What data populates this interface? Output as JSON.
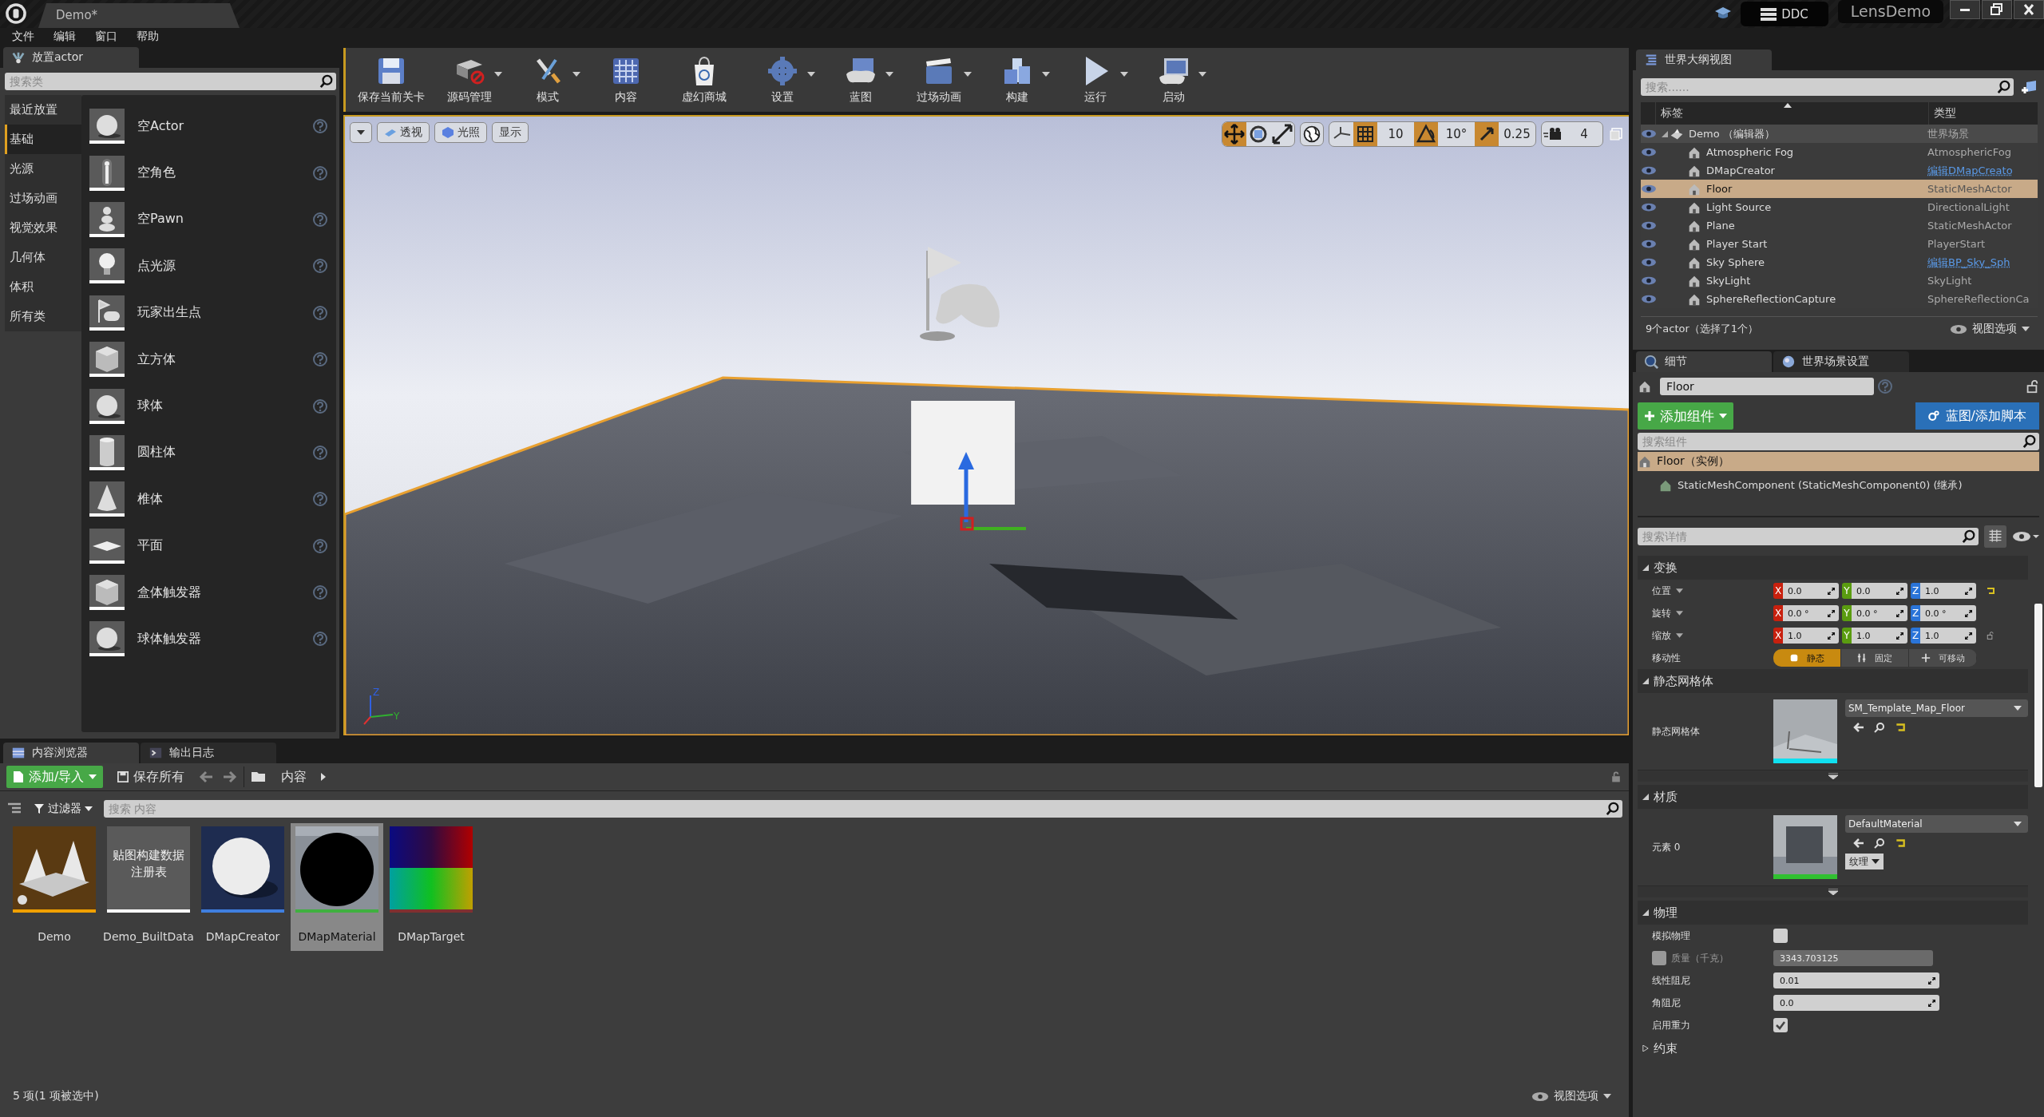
{
  "title_bar": {
    "tab": "Demo*",
    "ddc_button": "DDC",
    "project": "LensDemo"
  },
  "menu": [
    "文件",
    "编辑",
    "窗口",
    "帮助"
  ],
  "place_actors": {
    "tab": "放置actor",
    "search": {
      "placeholder": "搜索类"
    },
    "categories": [
      {
        "label": "最近放置",
        "selected": false
      },
      {
        "label": "基础",
        "selected": true
      },
      {
        "label": "光源",
        "selected": false
      },
      {
        "label": "过场动画",
        "selected": false
      },
      {
        "label": "视觉效果",
        "selected": false
      },
      {
        "label": "几何体",
        "selected": false
      },
      {
        "label": "体积",
        "selected": false
      },
      {
        "label": "所有类",
        "selected": false
      }
    ],
    "items": [
      "空Actor",
      "空角色",
      "空Pawn",
      "点光源",
      "玩家出生点",
      "立方体",
      "球体",
      "圆柱体",
      "椎体",
      "平面",
      "盒体触发器",
      "球体触发器"
    ]
  },
  "toolbar": [
    {
      "label": "保存当前关卡",
      "dropdown": false
    },
    {
      "label": "源码管理",
      "dropdown": true
    },
    {
      "label": "模式",
      "dropdown": true
    },
    {
      "label": "内容",
      "dropdown": false
    },
    {
      "label": "虚幻商城",
      "dropdown": false
    },
    {
      "label": "设置",
      "dropdown": true
    },
    {
      "label": "蓝图",
      "dropdown": true
    },
    {
      "label": "过场动画",
      "dropdown": true
    },
    {
      "label": "构建",
      "dropdown": true
    },
    {
      "label": "运行",
      "dropdown": true
    },
    {
      "label": "启动",
      "dropdown": true
    }
  ],
  "viewport": {
    "menu_buttons": [
      "透视",
      "光照",
      "显示"
    ],
    "transform_tools": [
      {
        "selected": true
      },
      {
        "selected": false
      },
      {
        "selected": false
      }
    ],
    "snaps": [
      {
        "value": "10",
        "on": true
      },
      {
        "value": "10°",
        "on": true
      },
      {
        "value": "0.25",
        "on": true
      }
    ],
    "camera_speed": "4",
    "axis_labels": [
      "Z",
      "Y"
    ]
  },
  "outliner": {
    "tab": "世界大纲视图",
    "search": {
      "placeholder": "搜索......"
    },
    "columns": [
      "标签",
      "类型"
    ],
    "rows": [
      {
        "label": "Demo （编辑器）",
        "type": "世界场景",
        "link": false,
        "selected": false,
        "expanded": true,
        "children": [
          {
            "label": "Atmospheric Fog",
            "type": "AtmosphericFog",
            "link": false,
            "selected": false
          },
          {
            "label": "DMapCreator",
            "type": "编辑DMapCreato",
            "link": true,
            "selected": false
          },
          {
            "label": "Floor",
            "type": "StaticMeshActor",
            "link": false,
            "selected": true
          },
          {
            "label": "Light Source",
            "type": "DirectionalLight",
            "link": false,
            "selected": false
          },
          {
            "label": "Plane",
            "type": "StaticMeshActor",
            "link": false,
            "selected": false
          },
          {
            "label": "Player Start",
            "type": "PlayerStart",
            "link": false,
            "selected": false
          },
          {
            "label": "Sky Sphere",
            "type": "编辑BP_Sky_Sph",
            "link": true,
            "selected": false
          },
          {
            "label": "SkyLight",
            "type": "SkyLight",
            "link": false,
            "selected": false
          },
          {
            "label": "SphereReflectionCapture",
            "type": "SphereReflectionCa",
            "link": false,
            "selected": false
          }
        ]
      }
    ],
    "footer": "9个actor（选择了1个）",
    "view_options": "视图选项"
  },
  "details": {
    "tabs": [
      {
        "label": "细节",
        "selected": true
      },
      {
        "label": "世界场景设置",
        "selected": false
      }
    ],
    "name": "Floor",
    "add_component": "添加组件",
    "blueprint_button": "蓝图/添加脚本",
    "component_search": {
      "placeholder": "搜索组件"
    },
    "components": [
      {
        "label": "Floor（实例）",
        "selected": true,
        "children": [
          {
            "label": "StaticMeshComponent (StaticMeshComponent0) (继承)",
            "selected": false
          }
        ]
      }
    ],
    "detail_search": {
      "placeholder": "搜索详情"
    },
    "transform": {
      "title": "变换",
      "expanded": true,
      "rows": [
        {
          "label": "位置",
          "values": [
            {
              "axis": "X",
              "value": "0.0"
            },
            {
              "axis": "Y",
              "value": "0.0"
            },
            {
              "axis": "Z",
              "value": "1.0"
            }
          ]
        },
        {
          "label": "旋转",
          "values": [
            {
              "axis": "X",
              "value": "0.0 °"
            },
            {
              "axis": "Y",
              "value": "0.0 °"
            },
            {
              "axis": "Z",
              "value": "0.0 °"
            }
          ]
        },
        {
          "label": "缩放",
          "values": [
            {
              "axis": "X",
              "value": "1.0"
            },
            {
              "axis": "Y",
              "value": "1.0"
            },
            {
              "axis": "Z",
              "value": "1.0"
            }
          ]
        }
      ],
      "mobility_label": "移动性",
      "mobility": [
        {
          "label": "静态",
          "selected": true
        },
        {
          "label": "固定",
          "selected": false
        },
        {
          "label": "可移动",
          "selected": false
        }
      ]
    },
    "static_mesh": {
      "title": "静态网格体",
      "expanded": true,
      "label": "静态网格体",
      "asset": "SM_Template_Map_Floor"
    },
    "materials": {
      "title": "材质",
      "expanded": true,
      "label": "元素 0",
      "asset": "DefaultMaterial",
      "texture_button": "纹理"
    },
    "physics": {
      "title": "物理",
      "expanded": true,
      "rows": [
        {
          "kind": "checkbox",
          "label": "模拟物理",
          "checked": false
        },
        {
          "kind": "override",
          "label": "质量（千克）",
          "checked": false,
          "value": "3343.703125"
        },
        {
          "kind": "number",
          "label": "线性阻尼",
          "value": "0.01"
        },
        {
          "kind": "number",
          "label": "角阻尼",
          "value": "0.0"
        },
        {
          "kind": "checkbox",
          "label": "启用重力",
          "checked": true
        }
      ]
    },
    "constraints": {
      "title": "约束",
      "expanded": false
    }
  },
  "content_browser": {
    "tabs": [
      {
        "label": "内容浏览器",
        "selected": true
      },
      {
        "label": "输出日志",
        "selected": false
      }
    ],
    "add_button": "添加/导入",
    "save_all": "保存所有",
    "path": "内容",
    "filter": "过滤器",
    "search": {
      "placeholder": "搜索 内容"
    },
    "assets": [
      {
        "label": "Demo",
        "color": "#f0a000",
        "selected": false
      },
      {
        "label": "Demo_BuiltData",
        "color": "#ffffff",
        "selected": false,
        "thumbnail_text": "贴图构建数据注册表"
      },
      {
        "label": "DMapCreator",
        "color": "#3f7fe0",
        "selected": false
      },
      {
        "label": "DMapMaterial",
        "color": "#40b040",
        "selected": true
      },
      {
        "label": "DMapTarget",
        "color": "#803030",
        "selected": false
      }
    ],
    "status": "5 项(1 项被选中)",
    "view_options": "视图选项"
  }
}
